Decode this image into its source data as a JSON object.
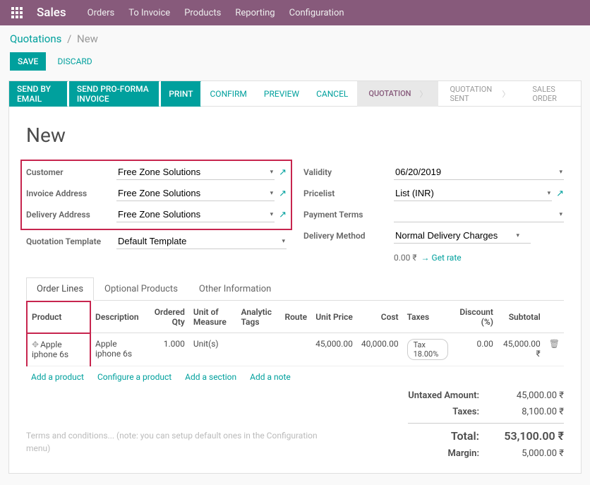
{
  "topbar": {
    "brand": "Sales",
    "menu": [
      "Orders",
      "To Invoice",
      "Products",
      "Reporting",
      "Configuration"
    ]
  },
  "breadcrumb": {
    "root": "Quotations",
    "current": "New"
  },
  "buttons": {
    "save": "SAVE",
    "discard": "DISCARD"
  },
  "statusbar": {
    "left": [
      "SEND BY EMAIL",
      "SEND PRO-FORMA INVOICE",
      "PRINT",
      "CONFIRM",
      "PREVIEW",
      "CANCEL"
    ],
    "steps": [
      "QUOTATION",
      "QUOTATION SENT",
      "SALES ORDER"
    ]
  },
  "title": "New",
  "left_fields": {
    "customer_label": "Customer",
    "customer_value": "Free Zone Solutions",
    "invoice_label": "Invoice Address",
    "invoice_value": "Free Zone Solutions",
    "delivery_label": "Delivery Address",
    "delivery_value": "Free Zone Solutions",
    "template_label": "Quotation Template",
    "template_value": "Default Template"
  },
  "right_fields": {
    "validity_label": "Validity",
    "validity_value": "06/20/2019",
    "pricelist_label": "Pricelist",
    "pricelist_value": "List (INR)",
    "payment_label": "Payment Terms",
    "payment_value": "",
    "delivery_label": "Delivery Method",
    "delivery_value": "Normal Delivery Charges",
    "rate_amount": "0.00 ₹",
    "rate_link": "Get rate"
  },
  "tabs": [
    "Order Lines",
    "Optional Products",
    "Other Information"
  ],
  "table": {
    "headers": {
      "product": "Product",
      "description": "Description",
      "qty": "Ordered Qty",
      "uom": "Unit of Measure",
      "tags": "Analytic Tags",
      "route": "Route",
      "price": "Unit Price",
      "cost": "Cost",
      "taxes": "Taxes",
      "discount": "Discount (%)",
      "subtotal": "Subtotal"
    },
    "rows": [
      {
        "product": "Apple iphone 6s",
        "description": "Apple iphone 6s",
        "qty": "1.000",
        "uom": "Unit(s)",
        "tags": "",
        "route": "",
        "price": "45,000.00",
        "cost": "40,000.00",
        "taxes": "Tax 18.00%",
        "discount": "0.00",
        "subtotal": "45,000.00 ₹"
      }
    ],
    "actions": [
      "Add a product",
      "Configure a product",
      "Add a section",
      "Add a note"
    ]
  },
  "terms": "Terms and conditions... (note: you can setup default ones in the Configuration menu)",
  "totals": {
    "untaxed_label": "Untaxed Amount:",
    "untaxed_value": "45,000.00",
    "taxes_label": "Taxes:",
    "taxes_value": "8,100.00",
    "total_label": "Total:",
    "total_value": "53,100.00",
    "margin_label": "Margin:",
    "margin_value": "5,000.00"
  }
}
